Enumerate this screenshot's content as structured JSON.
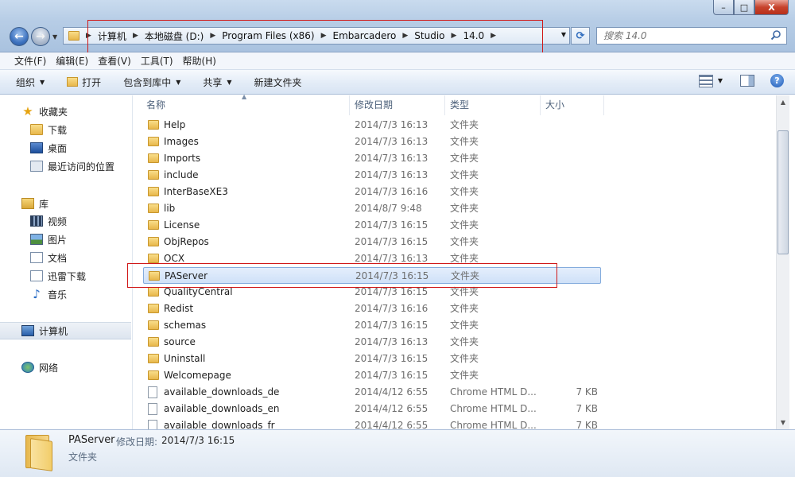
{
  "window": {
    "minimize": "–",
    "maximize": "□",
    "close": "X"
  },
  "address": {
    "breadcrumbs": [
      "计算机",
      "本地磁盘 (D:)",
      "Program Files (x86)",
      "Embarcadero",
      "Studio",
      "14.0"
    ],
    "search_placeholder": "搜索 14.0"
  },
  "menubar": [
    "文件(F)",
    "编辑(E)",
    "查看(V)",
    "工具(T)",
    "帮助(H)"
  ],
  "commandbar": {
    "organize": "组织",
    "open": "打开",
    "include_in_library": "包含到库中",
    "share": "共享",
    "new_folder": "新建文件夹"
  },
  "navpane": {
    "favorites": "收藏夹",
    "downloads": "下载",
    "desktop": "桌面",
    "recent": "最近访问的位置",
    "libraries": "库",
    "videos": "视频",
    "pictures": "图片",
    "documents": "文档",
    "thunder": "迅雷下载",
    "music": "音乐",
    "computer": "计算机",
    "network": "网络"
  },
  "columns": {
    "name": "名称",
    "date": "修改日期",
    "type": "类型",
    "size": "大小"
  },
  "files": [
    {
      "name": "Help",
      "date": "2014/7/3 16:13",
      "type": "文件夹",
      "size": "",
      "kind": "folder"
    },
    {
      "name": "Images",
      "date": "2014/7/3 16:13",
      "type": "文件夹",
      "size": "",
      "kind": "folder"
    },
    {
      "name": "Imports",
      "date": "2014/7/3 16:13",
      "type": "文件夹",
      "size": "",
      "kind": "folder"
    },
    {
      "name": "include",
      "date": "2014/7/3 16:13",
      "type": "文件夹",
      "size": "",
      "kind": "folder"
    },
    {
      "name": "InterBaseXE3",
      "date": "2014/7/3 16:16",
      "type": "文件夹",
      "size": "",
      "kind": "folder"
    },
    {
      "name": "lib",
      "date": "2014/8/7 9:48",
      "type": "文件夹",
      "size": "",
      "kind": "folder"
    },
    {
      "name": "License",
      "date": "2014/7/3 16:15",
      "type": "文件夹",
      "size": "",
      "kind": "folder"
    },
    {
      "name": "ObjRepos",
      "date": "2014/7/3 16:15",
      "type": "文件夹",
      "size": "",
      "kind": "folder"
    },
    {
      "name": "OCX",
      "date": "2014/7/3 16:13",
      "type": "文件夹",
      "size": "",
      "kind": "folder"
    },
    {
      "name": "PAServer",
      "date": "2014/7/3 16:15",
      "type": "文件夹",
      "size": "",
      "kind": "folder",
      "selected": true
    },
    {
      "name": "QualityCentral",
      "date": "2014/7/3 16:15",
      "type": "文件夹",
      "size": "",
      "kind": "folder"
    },
    {
      "name": "Redist",
      "date": "2014/7/3 16:16",
      "type": "文件夹",
      "size": "",
      "kind": "folder"
    },
    {
      "name": "schemas",
      "date": "2014/7/3 16:15",
      "type": "文件夹",
      "size": "",
      "kind": "folder"
    },
    {
      "name": "source",
      "date": "2014/7/3 16:13",
      "type": "文件夹",
      "size": "",
      "kind": "folder"
    },
    {
      "name": "Uninstall",
      "date": "2014/7/3 16:15",
      "type": "文件夹",
      "size": "",
      "kind": "folder"
    },
    {
      "name": "Welcomepage",
      "date": "2014/7/3 16:15",
      "type": "文件夹",
      "size": "",
      "kind": "folder"
    },
    {
      "name": "available_downloads_de",
      "date": "2014/4/12 6:55",
      "type": "Chrome HTML D...",
      "size": "7 KB",
      "kind": "file"
    },
    {
      "name": "available_downloads_en",
      "date": "2014/4/12 6:55",
      "type": "Chrome HTML D...",
      "size": "7 KB",
      "kind": "file"
    },
    {
      "name": "available_downloads_fr",
      "date": "2014/4/12 6:55",
      "type": "Chrome HTML D...",
      "size": "7 KB",
      "kind": "file"
    }
  ],
  "details": {
    "name": "PAServer",
    "date_label": "修改日期:",
    "date": "2014/7/3 16:15",
    "type": "文件夹"
  },
  "colors": {
    "highlight_box": "#d01818",
    "selection_border": "#84acdd"
  }
}
